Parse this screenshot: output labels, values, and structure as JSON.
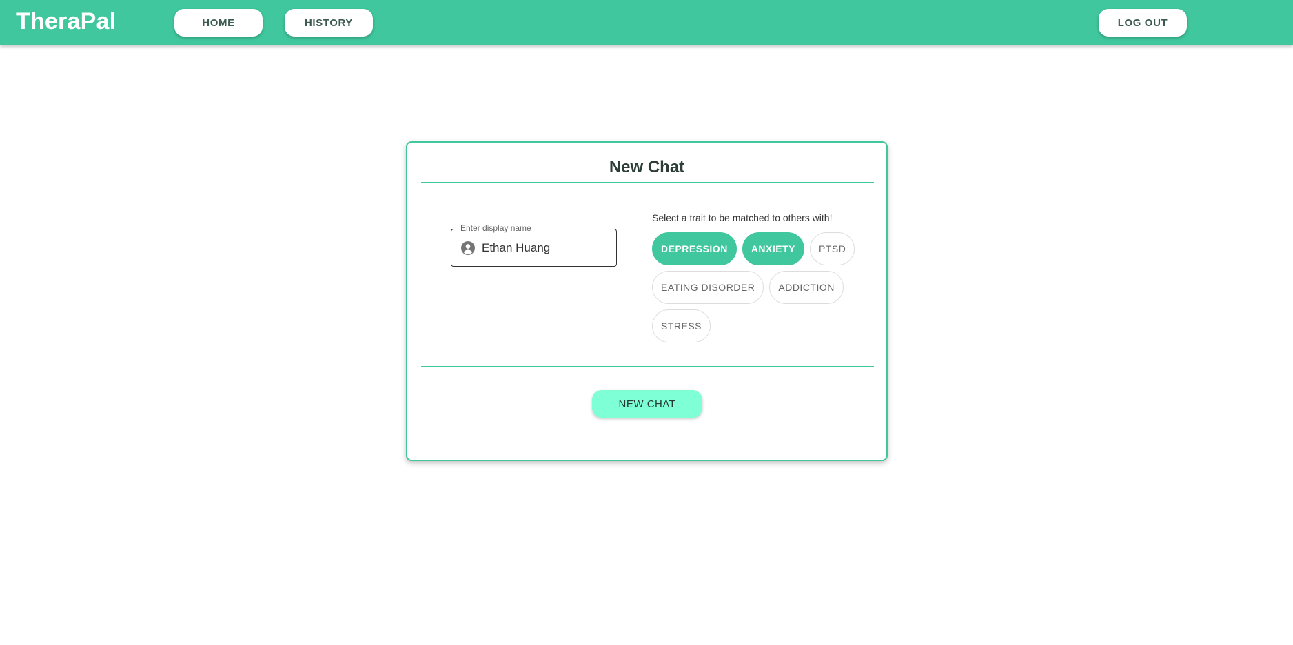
{
  "app": {
    "brand": "TheraPal"
  },
  "nav": {
    "home_label": "HOME",
    "history_label": "HISTORY",
    "logout_label": "LOG OUT"
  },
  "card": {
    "title": "New Chat",
    "display_name": {
      "label": "Enter display name",
      "value": "Ethan Huang",
      "icon": "account-circle-icon"
    },
    "trait_prompt": "Select a trait to be matched to others with!",
    "traits": [
      {
        "label": "DEPRESSION",
        "selected": true
      },
      {
        "label": "ANXIETY",
        "selected": true
      },
      {
        "label": "PTSD",
        "selected": false
      },
      {
        "label": "EATING DISORDER",
        "selected": false
      },
      {
        "label": "ADDICTION",
        "selected": false
      },
      {
        "label": "STRESS",
        "selected": false
      }
    ],
    "submit_label": "NEW CHAT"
  },
  "colors": {
    "primary": "#40c79d",
    "button_accent": "#7effd5",
    "text_dark": "#2d3e37"
  }
}
